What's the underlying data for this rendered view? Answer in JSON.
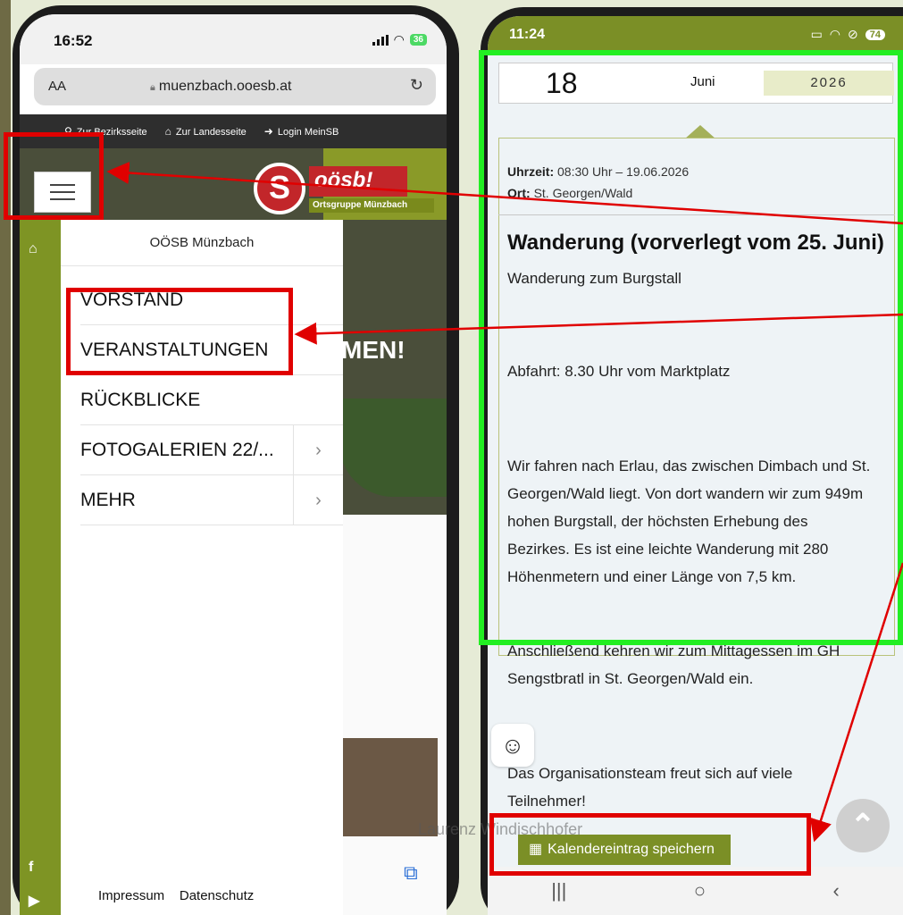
{
  "left_phone": {
    "status": {
      "time": "16:52",
      "battery": "36"
    },
    "browser": {
      "text_size_label": "AA",
      "url": "muenzbach.ooesb.at"
    },
    "top_nav": [
      "Zur Bezirksseite",
      "Zur Landesseite",
      "Login MeinSB"
    ],
    "logo": {
      "letter": "S",
      "name": "oösb!",
      "subtitle": "Ortsgruppe Münzbach"
    },
    "hero_title": "MEN!",
    "menu": {
      "header": "OÖSB Münzbach",
      "items": [
        {
          "label": "VORSTAND"
        },
        {
          "label": "VERANSTALTUNGEN"
        },
        {
          "label": "RÜCKBLICKE"
        },
        {
          "label": "FOTOGALERIEN 22/...",
          "has_submenu": true
        },
        {
          "label": "MEHR",
          "has_submenu": true
        }
      ]
    },
    "footer_links": [
      "Impressum",
      "Datenschutz"
    ],
    "icons": [
      "home-icon",
      "facebook-icon",
      "youtube-icon",
      "tabs-icon"
    ]
  },
  "right_phone": {
    "status": {
      "time": "11:24",
      "battery": "74"
    },
    "date": {
      "day": "18",
      "month": "Juni",
      "year": "2026"
    },
    "event": {
      "time_label": "Uhrzeit:",
      "time_value": "08:30 Uhr – 19.06.2026",
      "place_label": "Ort:",
      "place_value": "St. Georgen/Wald",
      "title": "Wanderung (vorverlegt vom 25. Juni)",
      "subtitle": "Wanderung zum Burgstall",
      "departure": "Abfahrt: 8.30 Uhr vom Marktplatz",
      "description": "Wir fahren nach Erlau, das zwischen Dimbach und St. Georgen/Wald liegt. Von dort wandern wir zum 949m hohen Burgstall, der höchsten Erhebung des Bezirkes. Es ist eine leichte Wanderung mit 280 Höhenmetern und einer Länge von 7,5 km.",
      "after": "Anschließend kehren wir zum Mittagessen im GH Sengstbratl in St. Georgen/Wald ein.",
      "closing": "Das Organisationsteam freut sich auf viele Teilnehmer!"
    },
    "calendar_button": "Kalendereintrag speichern",
    "watermark": "Laurenz Windischhofer",
    "icons": [
      "cookie-icon",
      "scroll-top-icon",
      "calendar-icon"
    ]
  },
  "colors": {
    "accent_olive": "#7b8f26",
    "annotation_red": "#e00000",
    "annotation_green": "#22ee22"
  }
}
